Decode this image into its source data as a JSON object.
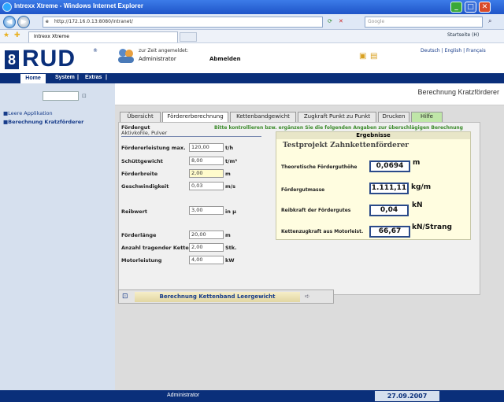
{
  "window": {
    "title": "Intrexx Xtreme - Windows Internet Explorer"
  },
  "browser": {
    "address": "http://172.16.0.13:8080/intranet/",
    "search_placeholder": "Google",
    "tab_label": "Intrexx Xtreme",
    "home_label": "Startseite (H)"
  },
  "header": {
    "logo": "RUD",
    "logo_reg": "®",
    "logged_in_label": "zur Zeit angemeldet:",
    "user": "Administrator",
    "logout": "Abmelden",
    "languages": "Deutsch | English | Français"
  },
  "menu": {
    "home": "Home",
    "system": "System",
    "extras": "Extras"
  },
  "sidebar": {
    "items": [
      {
        "label": "Leere Applikation"
      },
      {
        "label": "Berechnung Kratzförderer"
      }
    ]
  },
  "main": {
    "title": "Berechnung Kratzförderer",
    "tabs": [
      {
        "label": "Übersicht"
      },
      {
        "label": "Fördererberechnung"
      },
      {
        "label": "Kettenbandgewicht"
      },
      {
        "label": "Zugkraft Punkt zu Punkt"
      },
      {
        "label": "Drucken"
      },
      {
        "label": "Hilfe"
      }
    ],
    "note": "Bitte kontrollieren bzw. ergänzen Sie die folgenden Angaben zur überschlägigen Berechnung",
    "foerdergut_label": "Fördergut",
    "foerdergut_value": "Aktivkohle, Pulver",
    "fields": [
      {
        "label": "Fördererleistung max.",
        "value": "120,00",
        "unit": "t/h"
      },
      {
        "label": "Schüttgewicht",
        "value": "8,00",
        "unit": "t/m³"
      },
      {
        "label": "Förderbreite",
        "value": "2,00",
        "unit": "m"
      },
      {
        "label": "Geschwindigkeit",
        "value": "0,03",
        "unit": "m/s"
      },
      {
        "label": "Reibwert",
        "value": "3,00",
        "unit": "in µ"
      },
      {
        "label": "Förderlänge",
        "value": "20,00",
        "unit": "m"
      },
      {
        "label": "Anzahl tragender Ketten",
        "value": "2,00",
        "unit": "Stk."
      },
      {
        "label": "Motorleistung",
        "value": "4,00",
        "unit": "kW"
      }
    ],
    "results": {
      "header": "Ergebnisse",
      "subtitle": "Testprojekt Zahnkettenförderer",
      "rows": [
        {
          "label": "Theoretische Förderguthöhe",
          "value": "0,0694",
          "unit": "m"
        },
        {
          "label": "Fördergutmasse",
          "value": "1.111,11",
          "unit": "kg/m"
        },
        {
          "label": "Reibkraft der Fördergutes",
          "value": "0,04",
          "unit": "kN"
        },
        {
          "label": "Kettenzugkraft aus Motorleist.",
          "value": "66,67",
          "unit": "kN/Strang"
        }
      ]
    },
    "bottom_button": "Berechnung Kettenband Leergewicht"
  },
  "status": {
    "user": "Administrator",
    "date": "27.09.2007"
  }
}
